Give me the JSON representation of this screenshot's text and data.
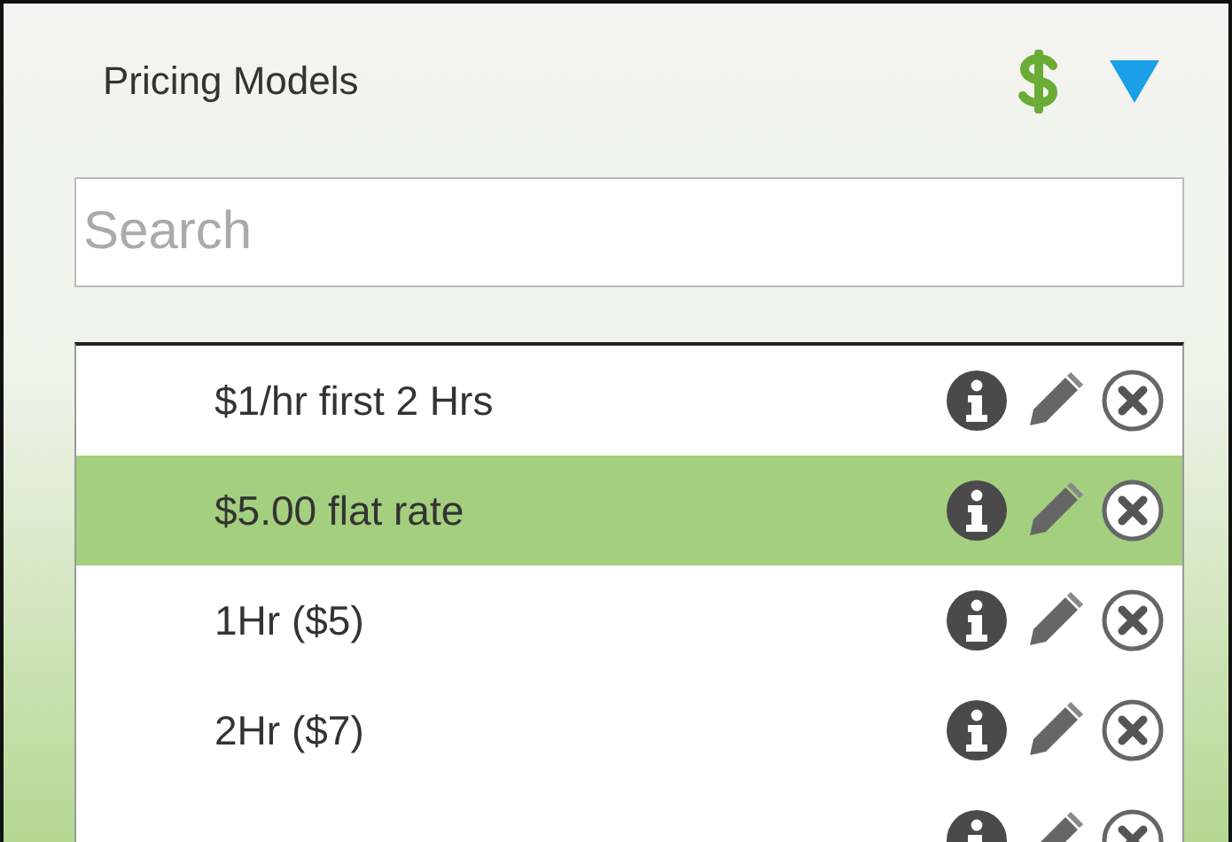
{
  "panel": {
    "title": "Pricing Models"
  },
  "search": {
    "placeholder": "Search"
  },
  "models": [
    {
      "label": "$1/hr first 2 Hrs",
      "selected": false
    },
    {
      "label": "$5.00 flat rate",
      "selected": true
    },
    {
      "label": "1Hr ($5)",
      "selected": false
    },
    {
      "label": "2Hr ($7)",
      "selected": false
    },
    {
      "selected": false
    }
  ]
}
